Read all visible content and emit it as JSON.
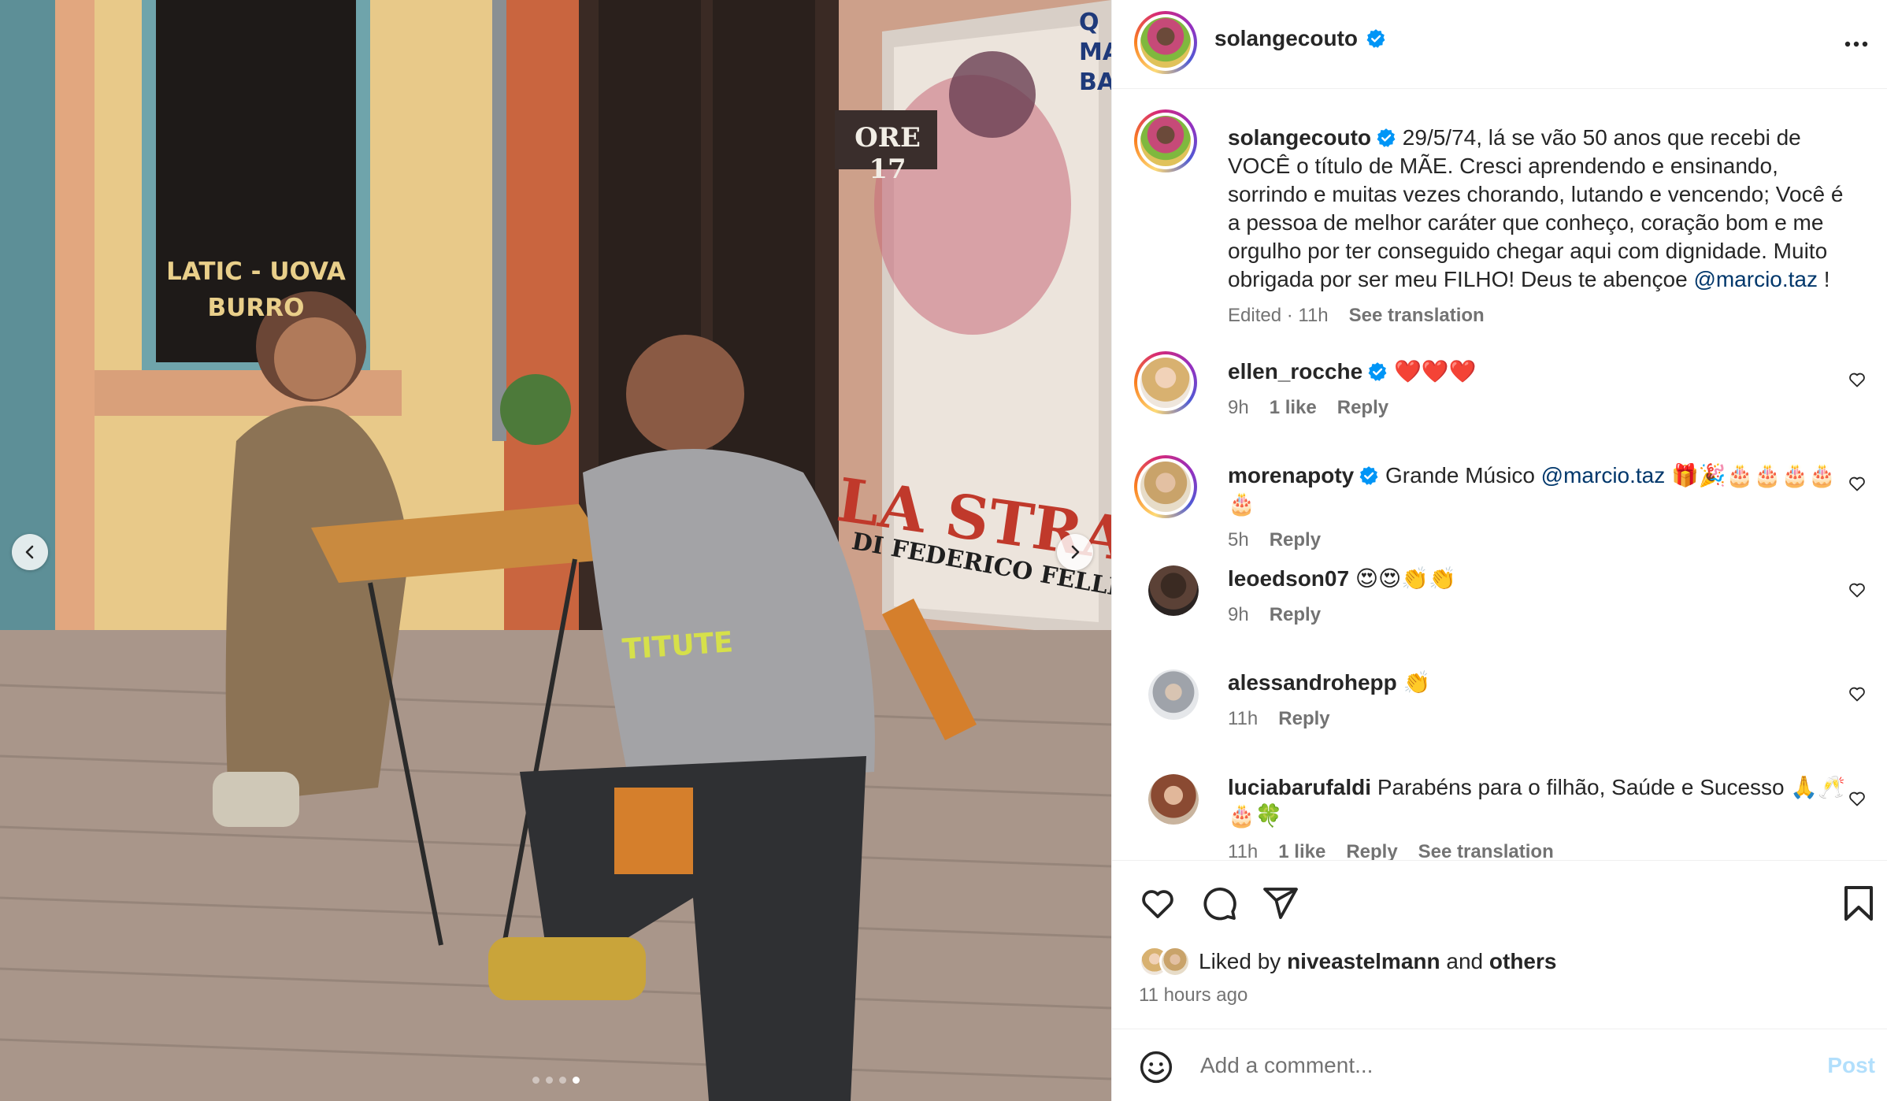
{
  "photo": {
    "sign_lines": [
      "LATIC - UOVA",
      "BURRO"
    ],
    "ore_sign": "ORE 17",
    "poster_title": "LA STRADA",
    "poster_subtitle": "DI FEDERICO FELLINI",
    "poster_corner": [
      "Q",
      "MA",
      "BAS"
    ],
    "shirt_text": "TITUTE",
    "slide_count": 4,
    "active_slide": 4
  },
  "post": {
    "author": "solangecouto",
    "verified": true,
    "caption_before_mention": "29/5/74, lá se vão 50 anos que recebi de VOCÊ o título de MÃE. Cresci aprendendo e ensinando, sorrindo e muitas vezes chorando, lutando e vencendo; Você é a pessoa de melhor caráter que conheço, coração bom e me orgulho por ter conseguido chegar aqui com dignidade. Muito obrigada por ser meu FILHO! Deus te abençoe",
    "caption_mention": "@marcio.taz",
    "caption_after_mention": " !",
    "caption_meta": "Edited · 11h",
    "see_translation": "See translation"
  },
  "comments": [
    {
      "user": "ellen_rocche",
      "verified": true,
      "text": "❤️❤️❤️",
      "time": "9h",
      "likes": "1 like",
      "reply": "Reply"
    },
    {
      "user": "morenapoty",
      "verified": true,
      "text_before": "Grande Músico ",
      "mention": "@marcio.taz",
      "text_after": " 🎁🎉🎂🎂🎂🎂🎂",
      "time": "5h",
      "reply": "Reply"
    },
    {
      "user": "leoedson07",
      "verified": false,
      "text": "😍😍👏👏",
      "time": "9h",
      "reply": "Reply"
    },
    {
      "user": "alessandrohepp",
      "verified": false,
      "text": "👏",
      "time": "11h",
      "reply": "Reply"
    },
    {
      "user": "luciabarufaldi",
      "verified": false,
      "text": "Parabéns para o filhão, Saúde e Sucesso 🙏🥂 🎂🍀",
      "time": "11h",
      "likes": "1 like",
      "reply": "Reply",
      "see_translation": "See translation"
    }
  ],
  "likes": {
    "prefix": "Liked by ",
    "user": "niveastelmann",
    "middle": " and ",
    "others": "others",
    "time_ago": "11 hours ago"
  },
  "comment_box": {
    "placeholder": "Add a comment...",
    "post_label": "Post"
  },
  "colors": {
    "verified": "#0095f6",
    "mention": "#00376b",
    "post_disabled": "#b2dffc",
    "muted": "#737373"
  }
}
